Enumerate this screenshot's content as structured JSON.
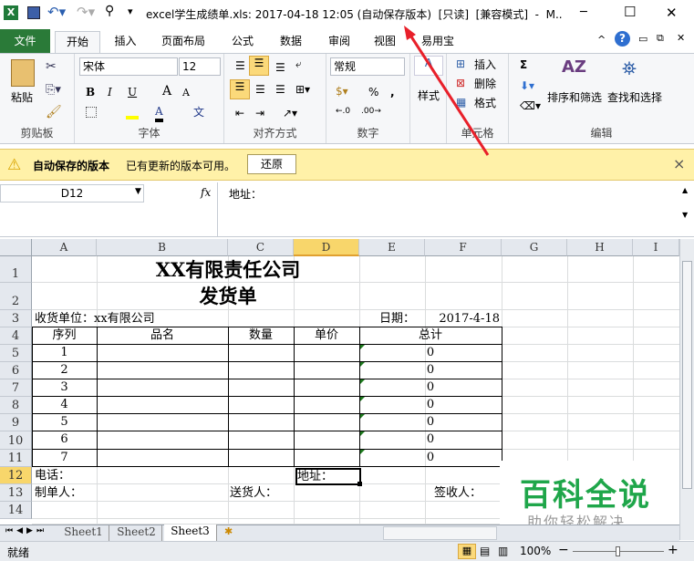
{
  "window": {
    "title": "excel学生成绩单.xls: 2017-04-18 12:05 (自动保存版本)  [只读]  [兼容模式]  -  M..",
    "minimize": "─",
    "maximize": "☐",
    "close": "✕"
  },
  "tabs": [
    {
      "label": "文件"
    },
    {
      "label": "开始"
    },
    {
      "label": "插入"
    },
    {
      "label": "页面布局"
    },
    {
      "label": "公式"
    },
    {
      "label": "数据"
    },
    {
      "label": "审阅"
    },
    {
      "label": "视图"
    },
    {
      "label": "易用宝"
    }
  ],
  "ribbon": {
    "clipboard": {
      "paste": "粘贴",
      "label": "剪贴板"
    },
    "font": {
      "name": "宋体",
      "size": "12",
      "bold": "B",
      "italic": "I",
      "underline": "U",
      "grow": "A",
      "shrink": "A",
      "fontcolor": "A",
      "phonetic": "文",
      "label": "字体"
    },
    "alignment": {
      "label": "对齐方式"
    },
    "number": {
      "format": "常规",
      "percent": "%",
      "comma": ",",
      "label": "数字"
    },
    "styles": {
      "label": "样式"
    },
    "cells": {
      "insert": "插入",
      "delete": "删除",
      "format": "格式",
      "label": "单元格"
    },
    "editing": {
      "sum": "Σ",
      "sort": "排序和筛选",
      "find": "查找和选择",
      "label": "编辑"
    }
  },
  "message": {
    "title": "自动保存的版本",
    "text": "已有更新的版本可用。",
    "restore": "还原",
    "close": "×"
  },
  "formula": {
    "namebox": "D12",
    "fx": "fx",
    "content": "地址："
  },
  "columns": [
    "A",
    "B",
    "C",
    "D",
    "E",
    "F",
    "G",
    "H",
    "I"
  ],
  "rows": [
    "1",
    "2",
    "3",
    "4",
    "5",
    "6",
    "7",
    "8",
    "9",
    "10",
    "11",
    "12",
    "13",
    "14"
  ],
  "sheet": {
    "title": "XX有限责任公司",
    "subtitle": "发货单",
    "receiver": "收货单位：xx有限公司",
    "date_label": "日期：",
    "date": "2017-4-18",
    "headers": [
      "序列",
      "品名",
      "数量",
      "单价",
      "总计"
    ],
    "items": [
      {
        "seq": "1",
        "total": "0"
      },
      {
        "seq": "2",
        "total": "0"
      },
      {
        "seq": "3",
        "total": "0"
      },
      {
        "seq": "4",
        "total": "0"
      },
      {
        "seq": "5",
        "total": "0"
      },
      {
        "seq": "6",
        "total": "0"
      },
      {
        "seq": "7",
        "total": "0"
      }
    ],
    "phone": "电话：",
    "address": "地址：",
    "maker": "制单人：",
    "sender": "送货人：",
    "signer": "签收人："
  },
  "sheettabs": [
    {
      "label": "Sheet1"
    },
    {
      "label": "Sheet2"
    },
    {
      "label": "Sheet3",
      "active": true
    }
  ],
  "status": {
    "ready": "就绪",
    "zoom": "100%",
    "minus": "−",
    "plus": "+"
  },
  "watermark": {
    "title": "百科全说",
    "subtitle": "助你轻松解决"
  },
  "colors": {
    "file_tab": "#2a7a38",
    "selected_header": "#f8d66b",
    "message_bar": "#fff1a8",
    "watermark": "#1fa64a",
    "arrow": "#e8202a"
  }
}
